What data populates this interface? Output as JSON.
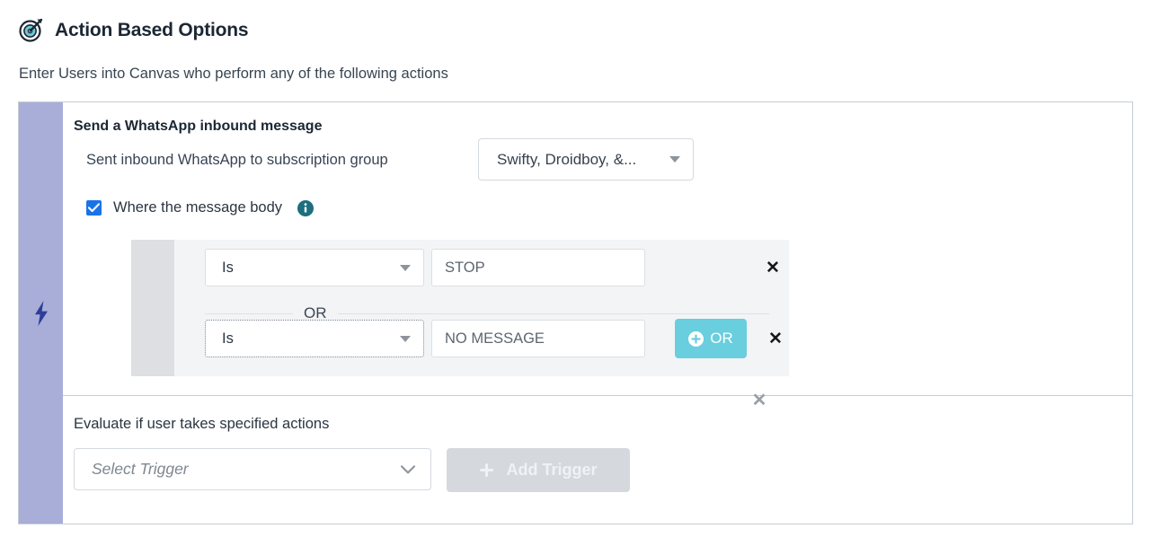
{
  "header": {
    "icon": "target-bullseye-icon",
    "title": "Action Based Options",
    "subtitle": "Enter Users into Canvas who perform any of the following actions"
  },
  "colors": {
    "accent_bar": "#a8aed8",
    "bolt": "#2f3d99",
    "checkbox": "#1a73e8",
    "info_icon": "#1d6e7e",
    "or_button": "#69cede",
    "add_trigger_button": "#d5d9dd",
    "card_border": "#c7cdd4",
    "filter_background": "#f3f4f6",
    "filter_gutter": "#dddfe3"
  },
  "card": {
    "accent_icon": "lightning-bolt-icon",
    "action": {
      "title": "Send a WhatsApp inbound message",
      "description": "Sent inbound WhatsApp to subscription group",
      "subscription_group": {
        "value": "Swifty, Droidboy, &...",
        "caret_icon": "caret-down-icon"
      },
      "message_body_filter": {
        "checked": true,
        "label": "Where the message body",
        "info_icon": "info-icon"
      },
      "conditions": [
        {
          "operator": "Is",
          "operator_caret_icon": "caret-down-icon",
          "value": "STOP",
          "remove_icon": "close-icon",
          "focused": false
        },
        {
          "operator": "Is",
          "operator_caret_icon": "caret-down-icon",
          "value": "NO MESSAGE",
          "remove_icon": "close-icon",
          "focused": true
        }
      ],
      "condition_divider_label": "OR",
      "add_or_button": {
        "label": "OR",
        "icon": "plus-circle-icon"
      },
      "remove_group_icon": "close-icon"
    },
    "trigger": {
      "label": "Evaluate if user takes specified actions",
      "select_placeholder": "Select Trigger",
      "select_chevron_icon": "chevron-down-icon",
      "add_button_label": "Add Trigger",
      "add_button_icon": "plus-icon"
    }
  }
}
